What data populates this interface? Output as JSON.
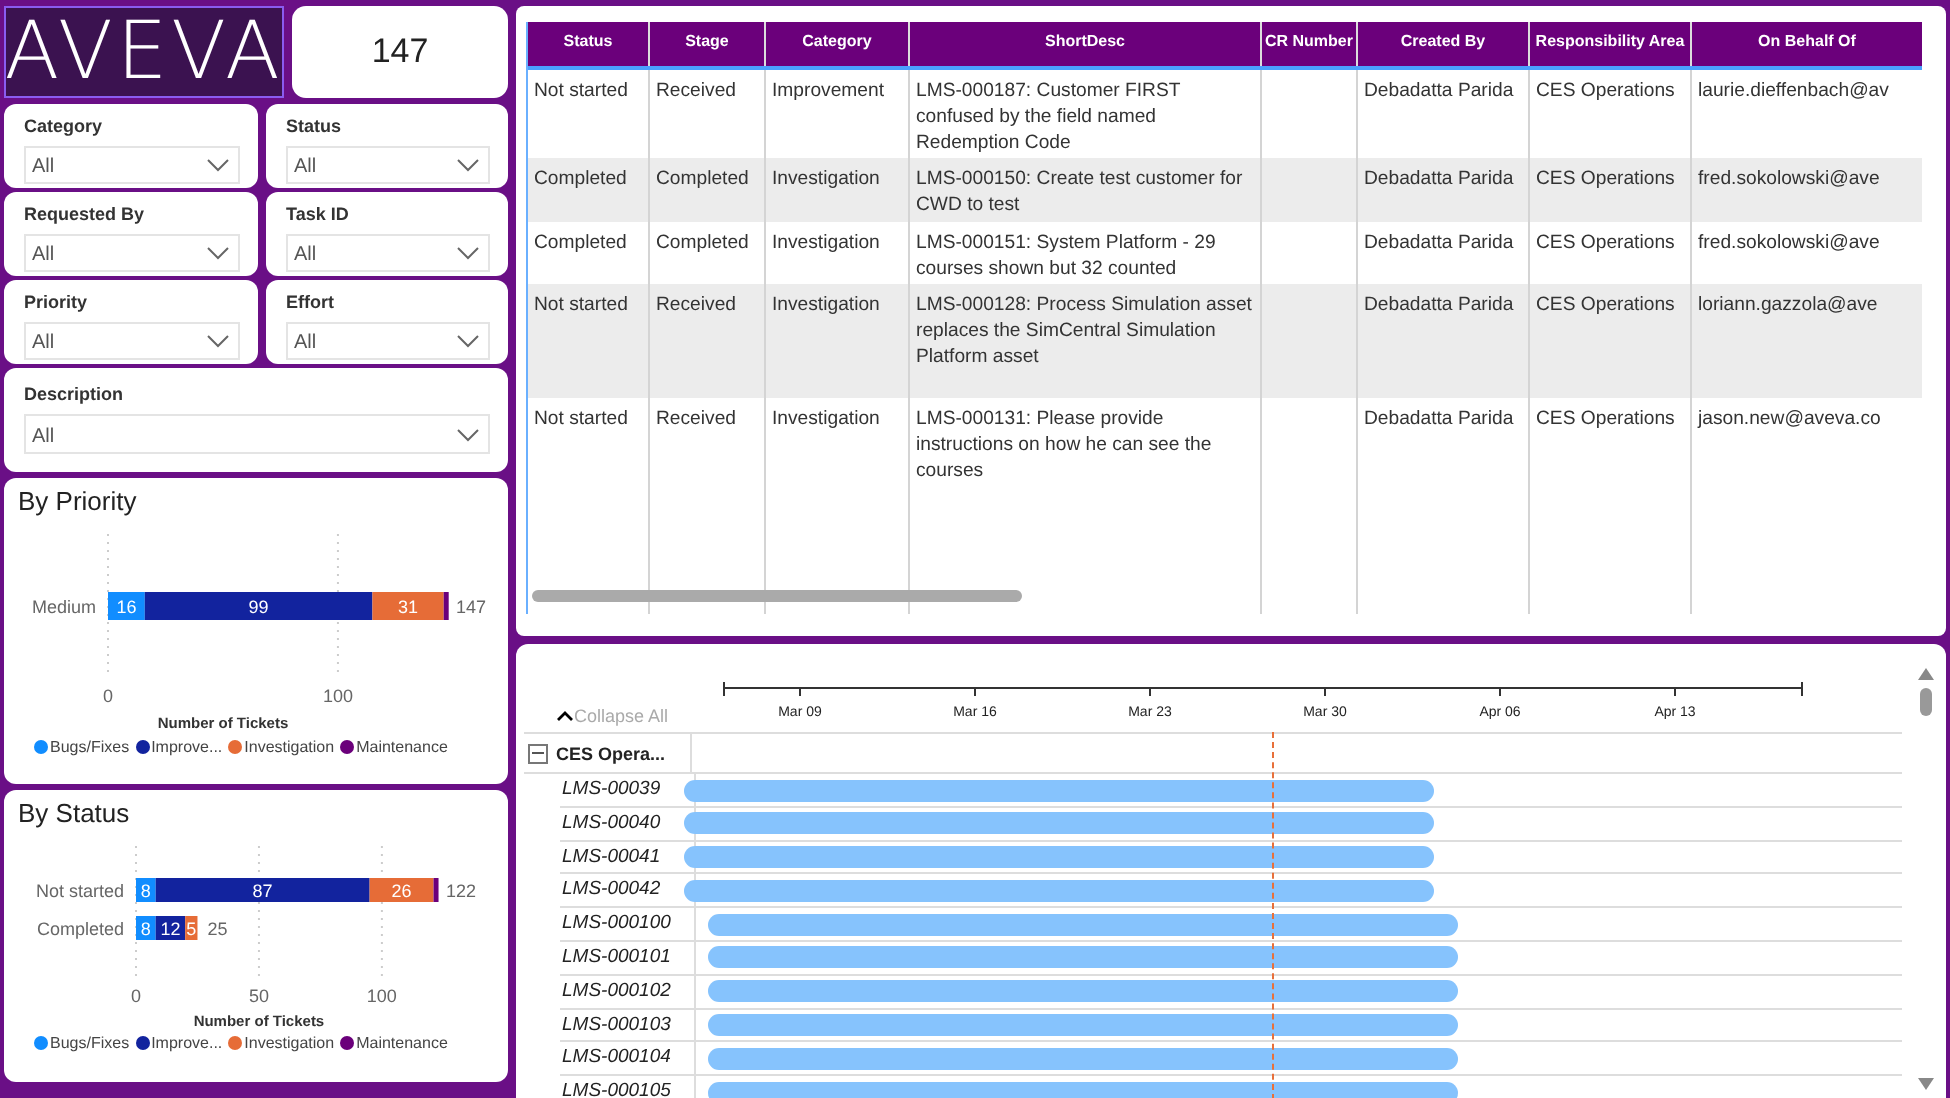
{
  "logo": {
    "text": "AVEVA"
  },
  "kpi": {
    "value": "147"
  },
  "filters": [
    {
      "label": "Category",
      "value": "All"
    },
    {
      "label": "Status",
      "value": "All"
    },
    {
      "label": "Requested By",
      "value": "All"
    },
    {
      "label": "Task ID",
      "value": "All"
    },
    {
      "label": "Priority",
      "value": "All"
    },
    {
      "label": "Effort",
      "value": "All"
    },
    {
      "label": "Description",
      "value": "All"
    }
  ],
  "charts": [
    {
      "title": "By Priority",
      "totals": [
        "147"
      ],
      "chart_data": {
        "type": "bar",
        "orientation": "horizontal",
        "stacked": true,
        "xlabel": "Number of Tickets",
        "categories": [
          "Medium"
        ],
        "xlim": [
          0,
          147
        ],
        "xticks": [
          0,
          100
        ],
        "series": [
          {
            "name": "Bugs/Fixes",
            "color": "#118dff",
            "values": [
              16
            ],
            "value_labels": [
              "16"
            ]
          },
          {
            "name": "Improve...",
            "color": "#12239e",
            "values": [
              99
            ],
            "value_labels": [
              "99"
            ]
          },
          {
            "name": "Investigation",
            "color": "#e66c37",
            "values": [
              31
            ],
            "value_labels": [
              "31"
            ]
          },
          {
            "name": "Maintenance",
            "color": "#6b007b",
            "values": [
              1
            ],
            "value_labels": [
              null
            ]
          }
        ]
      }
    },
    {
      "title": "By Status",
      "totals": [
        "122",
        "25"
      ],
      "chart_data": {
        "type": "bar",
        "orientation": "horizontal",
        "stacked": true,
        "xlabel": "Number of Tickets",
        "categories": [
          "Not started",
          "Completed"
        ],
        "xlim": [
          0,
          122
        ],
        "xticks": [
          0,
          50,
          100
        ],
        "series": [
          {
            "name": "Bugs/Fixes",
            "color": "#118dff",
            "values": [
              8,
              8
            ],
            "value_labels": [
              "8",
              "8"
            ]
          },
          {
            "name": "Improve...",
            "color": "#12239e",
            "values": [
              87,
              12
            ],
            "value_labels": [
              "87",
              "12"
            ]
          },
          {
            "name": "Investigation",
            "color": "#e66c37",
            "values": [
              26,
              5
            ],
            "value_labels": [
              "26",
              "5"
            ]
          },
          {
            "name": "Maintenance",
            "color": "#6b007b",
            "values": [
              1,
              0
            ],
            "value_labels": [
              null,
              null
            ]
          }
        ]
      }
    }
  ],
  "table": {
    "columns": [
      "Status",
      "Stage",
      "Category",
      "ShortDesc",
      "CR Number",
      "Created By",
      "Responsibility Area",
      "On Behalf Of"
    ],
    "rows": [
      [
        "Not started",
        "Received",
        "Improvement",
        "LMS-000187: Customer FIRST confused by the field named Redemption Code",
        "",
        "Debadatta Parida",
        "CES Operations",
        "laurie.dieffenbach@av"
      ],
      [
        "Completed",
        "Completed",
        "Investigation",
        "LMS-000150: Create test customer for CWD to test",
        "",
        "Debadatta Parida",
        "CES Operations",
        "fred.sokolowski@ave"
      ],
      [
        "Completed",
        "Completed",
        "Investigation",
        "LMS-000151: System Platform - 29 courses shown but 32 counted",
        "",
        "Debadatta Parida",
        "CES Operations",
        "fred.sokolowski@ave"
      ],
      [
        "Not started",
        "Received",
        "Investigation",
        "LMS-000128: Process Simulation asset replaces the SimCentral Simulation Platform asset",
        "",
        "Debadatta Parida",
        "CES Operations",
        "loriann.gazzola@ave"
      ],
      [
        "Not started",
        "Received",
        "Investigation",
        "LMS-000131: Please provide instructions on how he can see the courses",
        "",
        "Debadatta Parida",
        "CES Operations",
        "jason.new@aveva.co"
      ]
    ]
  },
  "gantt": {
    "collapse_label": "Collapse All",
    "ticks": [
      "Mar 09",
      "Mar 16",
      "Mar 23",
      "Mar 30",
      "Apr 06",
      "Apr 13"
    ],
    "groups": [
      {
        "name": "CES Opera...",
        "expanded": true,
        "children": [
          {
            "name": "LMS-00039",
            "kind": "early"
          },
          {
            "name": "LMS-00040",
            "kind": "early"
          },
          {
            "name": "LMS-00041",
            "kind": "early"
          },
          {
            "name": "LMS-00042",
            "kind": "early"
          },
          {
            "name": "LMS-000100",
            "kind": "late"
          },
          {
            "name": "LMS-000101",
            "kind": "late"
          },
          {
            "name": "LMS-000102",
            "kind": "late"
          },
          {
            "name": "LMS-000103",
            "kind": "late"
          },
          {
            "name": "LMS-000104",
            "kind": "late"
          },
          {
            "name": "LMS-000105",
            "kind": "late"
          }
        ]
      }
    ]
  }
}
